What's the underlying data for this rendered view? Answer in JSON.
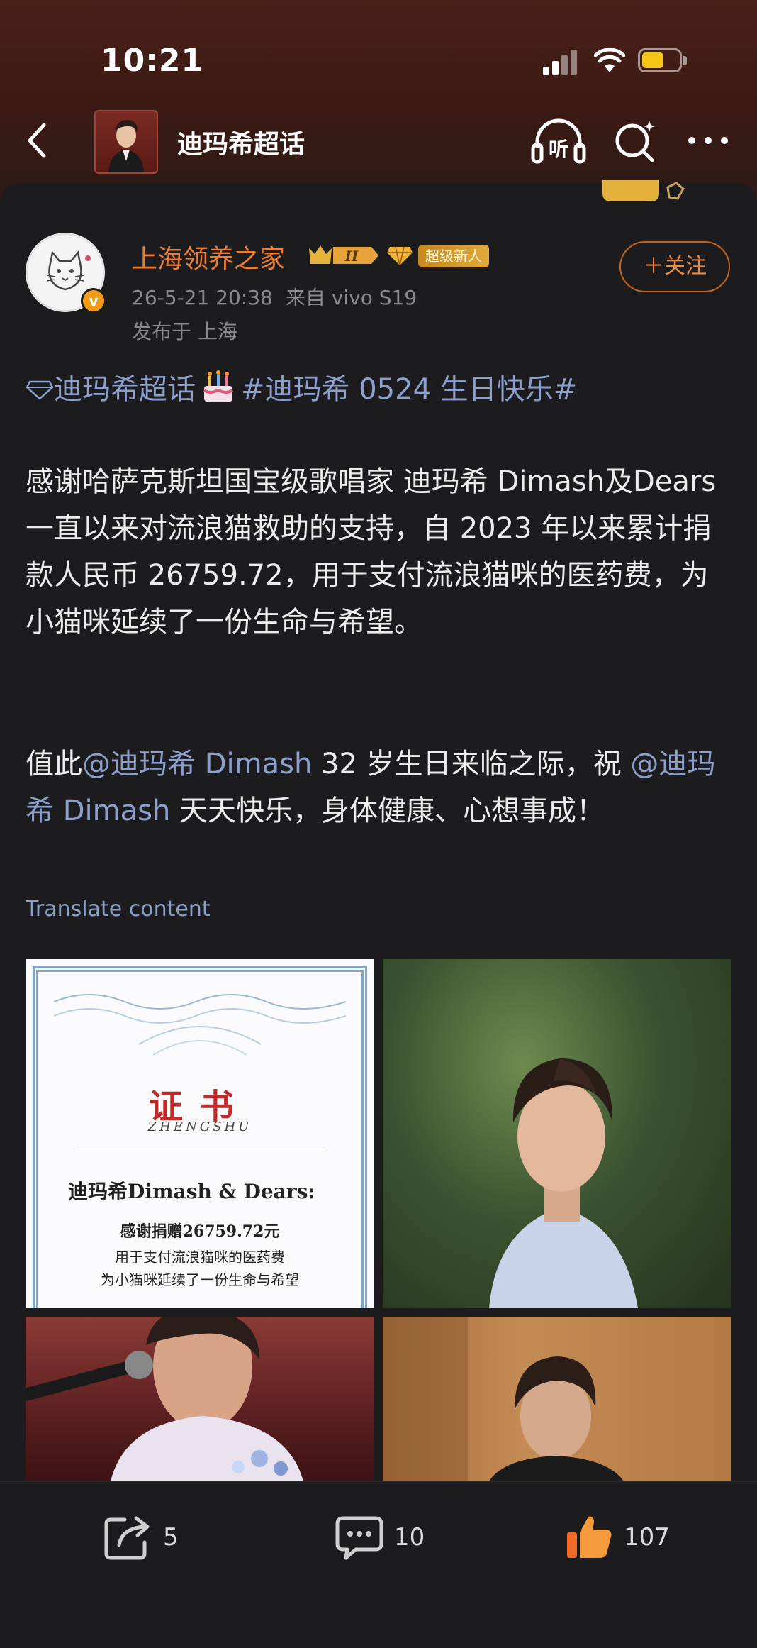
{
  "status_bar": {
    "time": "10:21",
    "battery_level": 0.6
  },
  "nav": {
    "title": "迪玛希超话",
    "listen_label": "听"
  },
  "post": {
    "author": "上海领养之家",
    "level_badge": "II",
    "new_tag": "超级新人",
    "timestamp": "26-5-21 20:38",
    "source": "来自 vivo S19",
    "location": "发布于 上海",
    "follow_label": "＋关注",
    "topic_supertopic": "迪玛希超话",
    "topic_hashtag": "#迪玛希 0524 生日快乐#",
    "paragraph1": "感谢哈萨克斯坦国宝级歌唱家 迪玛希 Dimash及Dears 一直以来对流浪猫救助的支持，自 2023 年以来累计捐款人民币 26759.72，用于支付流浪猫咪的医药费，为小猫咪延续了一份生命与希望。",
    "p2_prefix": "值此",
    "mention1": "@迪玛希 Dimash",
    "p2_mid": " 32 岁生日来临之际，祝 ",
    "mention2": "@迪玛希 Dimash",
    "p2_suffix": " 天天快乐，身体健康、心想事成！",
    "translate_label": "Translate content"
  },
  "certificate": {
    "title": "证书",
    "subtitle": "ZHENGSHU",
    "name_line": "迪玛希Dimash & Dears:",
    "thanks_line": "感谢捐赠26759.72元",
    "use_line": "用于支付流浪猫咪的医药费",
    "hope_line": "为小猫咪延续了一份生命与希望"
  },
  "actions": {
    "share_count": "5",
    "comment_count": "10",
    "like_count": "107"
  },
  "colors": {
    "accent_orange": "#ee7d2e",
    "link_blue": "#8d9fcc",
    "background": "#1c1c1e"
  }
}
